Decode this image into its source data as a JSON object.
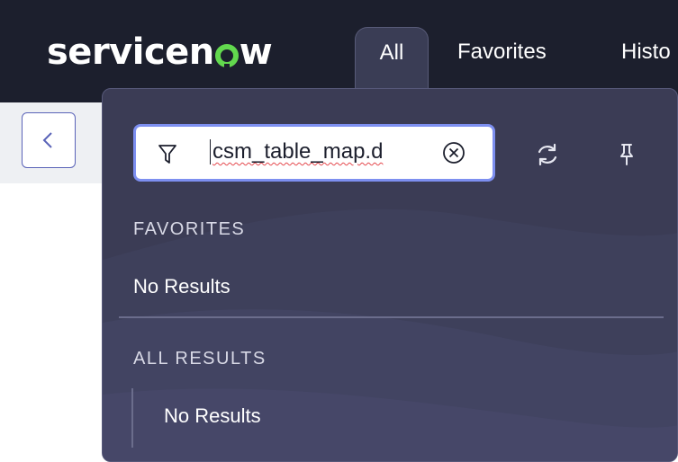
{
  "brand": {
    "logo_text_pre": "servicen",
    "logo_text_post": "w",
    "accent": "#62d84e"
  },
  "nav": {
    "tabs": [
      {
        "label": "All"
      },
      {
        "label": "Favorites"
      },
      {
        "label": "Histo"
      }
    ]
  },
  "filter": {
    "value": "csm_table_map.d",
    "icons": {
      "filter": "filter-icon",
      "clear": "clear-circle-icon",
      "refresh": "refresh-icon",
      "pin": "pin-icon"
    }
  },
  "sections": {
    "favorites": {
      "label": "FAVORITES",
      "empty": "No Results"
    },
    "all_results": {
      "label": "ALL RESULTS",
      "empty": "No Results"
    }
  },
  "page": {
    "back_icon": "chevron-left-icon"
  },
  "colors": {
    "nav_bg": "#1c1f2d",
    "panel_bg": "#3b3c55",
    "focus_ring": "#7d8ff0"
  }
}
